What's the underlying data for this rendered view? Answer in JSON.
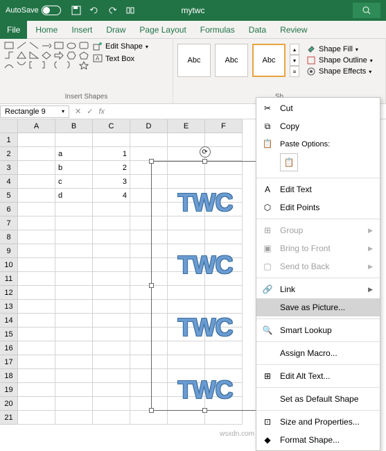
{
  "titlebar": {
    "autosave": "AutoSave",
    "docname": "mytwc"
  },
  "tabs": [
    "File",
    "Home",
    "Insert",
    "Draw",
    "Page Layout",
    "Formulas",
    "Data",
    "Review"
  ],
  "ribbon": {
    "insert_shapes_label": "Insert Shapes",
    "edit_shape": "Edit Shape",
    "text_box": "Text Box",
    "style_preview": "Abc",
    "shape_styles_label": "Sh",
    "shape_fill": "Shape Fill",
    "shape_outline": "Shape Outline",
    "shape_effects": "Shape Effects"
  },
  "namebox": "Rectangle 9",
  "columns": [
    "A",
    "B",
    "C",
    "D",
    "E",
    "F"
  ],
  "rows": 21,
  "cell_data": {
    "B2": "a",
    "C2": "1",
    "B3": "b",
    "C3": "2",
    "B4": "c",
    "C4": "3",
    "B5": "d",
    "C5": "4"
  },
  "wordart_text": "TWC",
  "context_menu": {
    "cut": "Cut",
    "copy": "Copy",
    "paste_options": "Paste Options:",
    "edit_text": "Edit Text",
    "edit_points": "Edit Points",
    "group": "Group",
    "bring_front": "Bring to Front",
    "send_back": "Send to Back",
    "link": "Link",
    "save_as_picture": "Save as Picture...",
    "smart_lookup": "Smart Lookup",
    "assign_macro": "Assign Macro...",
    "edit_alt_text": "Edit Alt Text...",
    "set_default": "Set as Default Shape",
    "size_props": "Size and Properties...",
    "format_shape": "Format Shape..."
  },
  "watermark": "wsxdn.com"
}
